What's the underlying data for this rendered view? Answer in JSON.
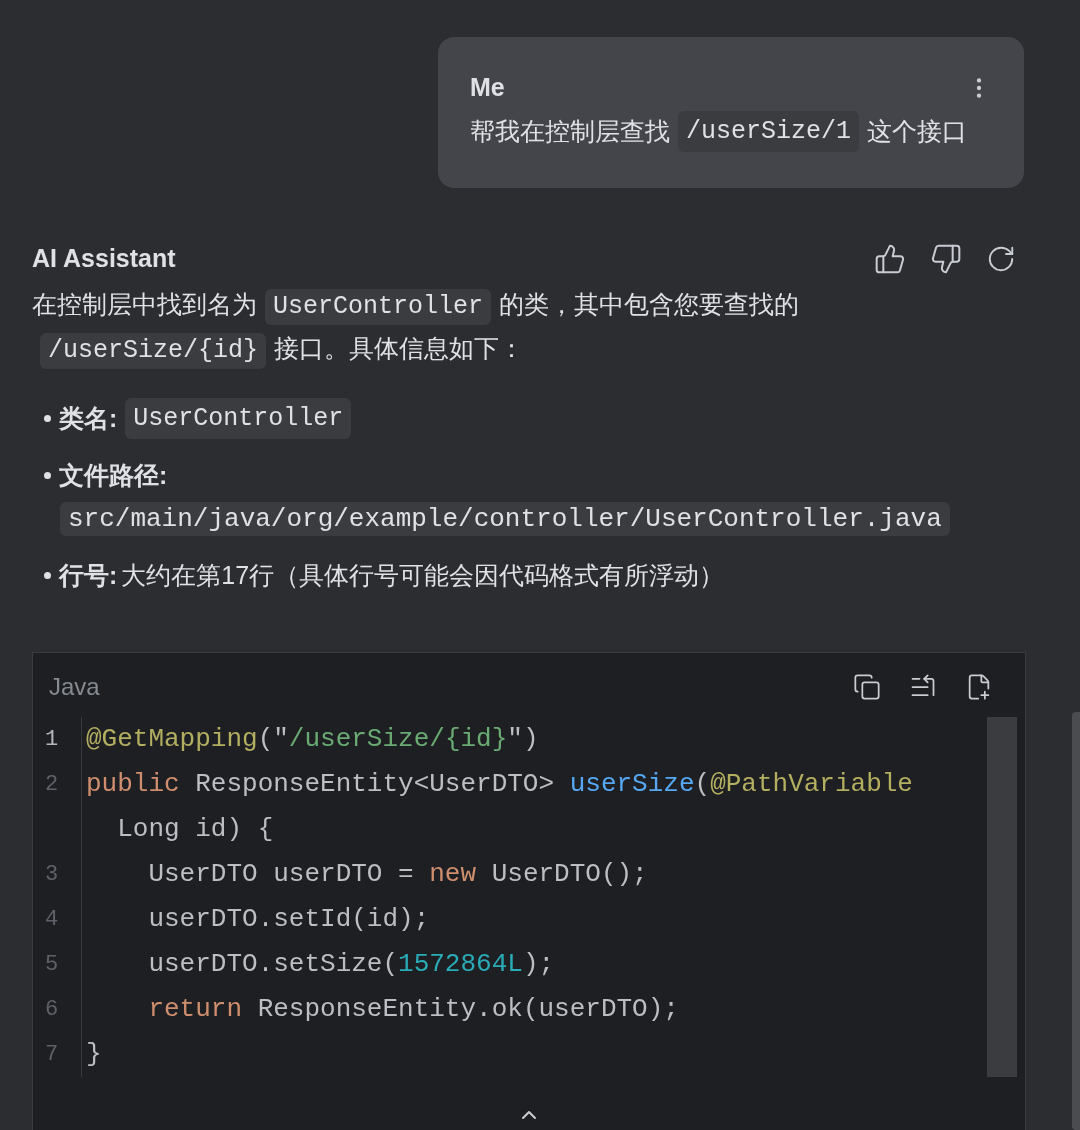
{
  "user_message": {
    "author": "Me",
    "segments": [
      {
        "kind": "text",
        "text": "帮我在控制层查找"
      },
      {
        "kind": "code",
        "text": "/userSize/1"
      },
      {
        "kind": "text",
        "text": "这个接口"
      }
    ]
  },
  "assistant_message": {
    "author": "AI Assistant",
    "paragraph": [
      {
        "kind": "text",
        "text": "在控制层中找到名为"
      },
      {
        "kind": "code",
        "text": "UserController"
      },
      {
        "kind": "text",
        "text": "的类，其中包含您要查找的"
      },
      {
        "kind": "code",
        "text": "/userSize/{id}"
      },
      {
        "kind": "text",
        "text": "接口。具体信息如下："
      }
    ],
    "bullets": [
      {
        "label": "类名:",
        "value": "UserController",
        "kind": "code"
      },
      {
        "label": "文件路径:",
        "value": "src/main/java/org/example/controller/UserController.java",
        "kind": "code_block"
      },
      {
        "label": "行号:",
        "value": "大约在第17行（具体行号可能会因代码格式有所浮动）",
        "kind": "text"
      }
    ],
    "code_block": {
      "language": "Java",
      "lines": [
        {
          "number": "1",
          "current": true,
          "tokens": [
            {
              "kind": "annotation",
              "text": "@GetMapping"
            },
            {
              "kind": "plain",
              "text": "(\""
            },
            {
              "kind": "string",
              "text": "/userSize/{id}"
            },
            {
              "kind": "plain",
              "text": "\")"
            }
          ]
        },
        {
          "number": "2",
          "current": false,
          "tokens": [
            {
              "kind": "keyword",
              "text": "public "
            },
            {
              "kind": "plain",
              "text": "ResponseEntity<UserDTO> "
            },
            {
              "kind": "method",
              "text": "userSize"
            },
            {
              "kind": "plain",
              "text": "("
            },
            {
              "kind": "annotation",
              "text": "@PathVariable"
            }
          ]
        },
        {
          "tokens": [
            {
              "kind": "plain",
              "text": "  Long id) {"
            }
          ]
        },
        {
          "number": "3",
          "current": false,
          "tokens": [
            {
              "kind": "plain",
              "text": "    UserDTO userDTO = "
            },
            {
              "kind": "keyword",
              "text": "new"
            },
            {
              "kind": "plain",
              "text": " UserDTO();"
            }
          ]
        },
        {
          "number": "4",
          "current": false,
          "tokens": [
            {
              "kind": "plain",
              "text": "    userDTO.setId(id);"
            }
          ]
        },
        {
          "number": "5",
          "current": false,
          "tokens": [
            {
              "kind": "plain",
              "text": "    userDTO.setSize("
            },
            {
              "kind": "number",
              "text": "1572864L"
            },
            {
              "kind": "plain",
              "text": ");"
            }
          ]
        },
        {
          "number": "6",
          "current": false,
          "tokens": [
            {
              "kind": "keyword",
              "text": "    return"
            },
            {
              "kind": "plain",
              "text": " ResponseEntity.ok(userDTO);"
            }
          ]
        },
        {
          "number": "7",
          "current": false,
          "tokens": [
            {
              "kind": "plain",
              "text": "}"
            }
          ]
        }
      ]
    }
  }
}
